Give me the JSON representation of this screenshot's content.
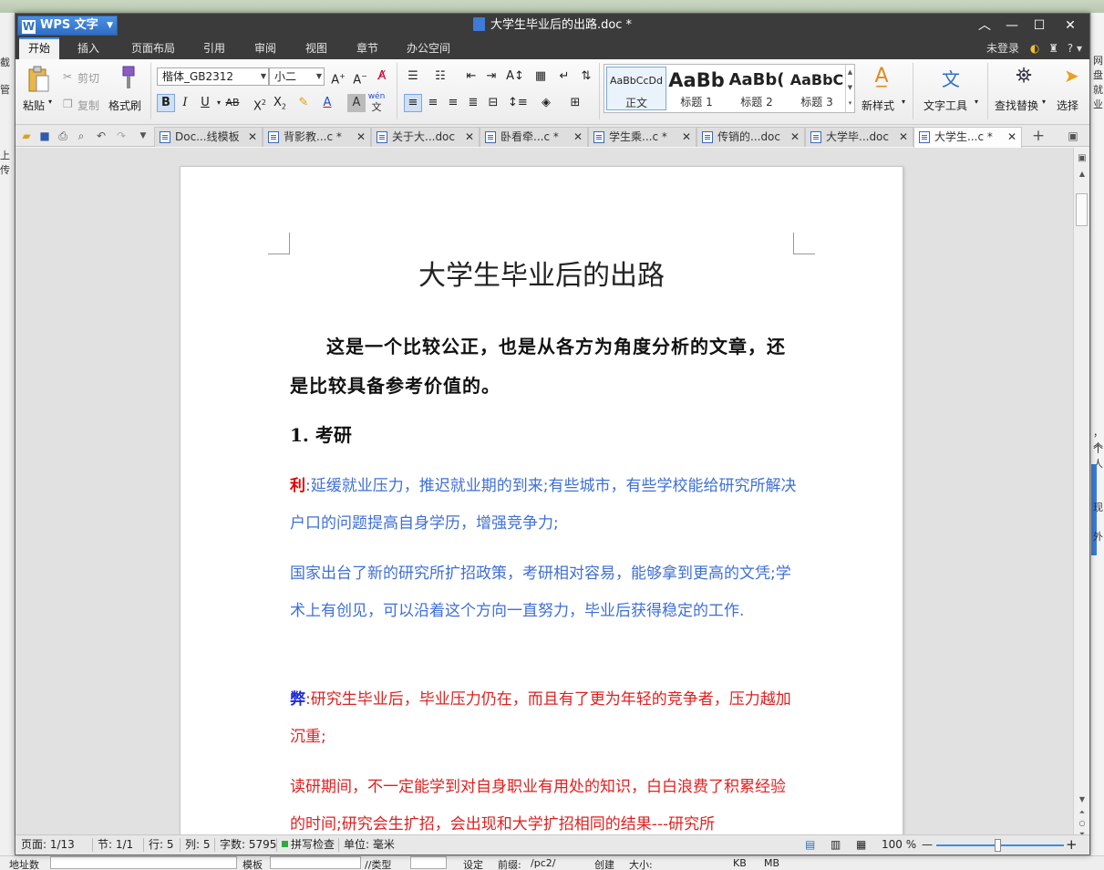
{
  "app": {
    "name": "WPS 文字",
    "doc_title": "大学生毕业后的出路.doc *",
    "login": "未登录"
  },
  "menu": [
    "开始",
    "插入",
    "页面布局",
    "引用",
    "审阅",
    "视图",
    "章节",
    "办公空间"
  ],
  "ribbon": {
    "paste": "粘贴",
    "cut": "剪切",
    "copy": "复制",
    "format_painter": "格式刷",
    "font_name": "楷体_GB2312",
    "font_size": "小二",
    "ruby_glyph": "wén",
    "styles": [
      {
        "preview": "AaBbCcDd",
        "name": "正文"
      },
      {
        "preview": "AaBb",
        "name": "标题 1"
      },
      {
        "preview": "AaBb(",
        "name": "标题 2"
      },
      {
        "preview": "AaBbC",
        "name": "标题 3"
      }
    ],
    "new_style": "新样式",
    "text_tools": "文字工具",
    "find_replace": "查找替换",
    "select": "选择"
  },
  "tabs": [
    {
      "label": "Doc...线模板",
      "active": false
    },
    {
      "label": "背影教...c *",
      "active": false
    },
    {
      "label": "关于大...doc",
      "active": false
    },
    {
      "label": "卧看牵...c *",
      "active": false
    },
    {
      "label": "学生乘...c *",
      "active": false
    },
    {
      "label": "传销的...doc",
      "active": false
    },
    {
      "label": "大学毕...doc",
      "active": false
    },
    {
      "label": "大学生...c *",
      "active": true
    }
  ],
  "document": {
    "title": "大学生毕业后的出路",
    "intro": "这是一个比较公正，也是从各方为角度分析的文章，还是比较具备参考价值的。",
    "section1": "1. 考研",
    "pro_label": "利",
    "pro_p1": ":延缓就业压力，推迟就业期的到来;有些城市，有些学校能给研究所解决户口的问题提高自身学历，增强竞争力;",
    "pro_p2": "国家出台了新的研究所扩招政策，考研相对容易，能够拿到更高的文凭;学术上有创见，可以沿着这个方向一直努力，毕业后获得稳定的工作.",
    "con_label": "弊",
    "con_p1": ":研究生毕业后，毕业压力仍在，而且有了更为年轻的竞争者，压力越加沉重;",
    "con_p2": "读研期间，不一定能学到对自身职业有用处的知识，白白浪费了积累经验的时间;研究会生扩招，会出现和大学扩招相同的结果---研究所"
  },
  "status": {
    "page": "页面: 1/13",
    "section": "节: 1/1",
    "row": "行: 5",
    "col": "列: 5",
    "words": "字数: 5795",
    "spell": "拼写检查",
    "unit": "单位: 毫米",
    "zoom": "100 %"
  },
  "background": {
    "left_1": "截",
    "left_2": "管",
    "left_3": "上传",
    "right_1": "网盘",
    "right_2": "就业",
    "right_3": "，个",
    "right_4": "个人",
    "right_5": "现",
    "right_6": "外",
    "bottom_1": "地址数",
    "bottom_2": "模板",
    "bottom_3": "//类型",
    "bottom_4": "设定",
    "bottom_5": "前缀:",
    "bottom_6": "/pc2/",
    "bottom_7": "创建",
    "bottom_8": "大小:",
    "bottom_9": "KB",
    "bottom_10": "MB"
  }
}
